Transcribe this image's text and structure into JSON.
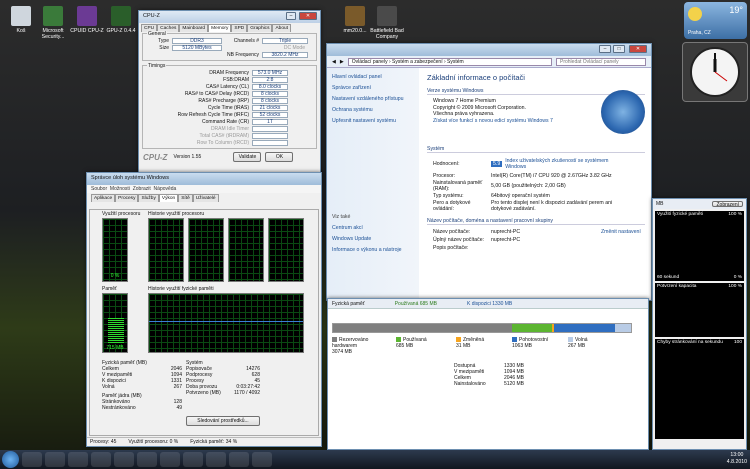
{
  "desktop": {
    "icons": [
      {
        "label": "Koš",
        "color": "#cfd6dd"
      },
      {
        "label": "Microsoft Security...",
        "color": "#3a7a3a"
      },
      {
        "label": "CPUID CPU-Z",
        "color": "#6b3a94"
      },
      {
        "label": "GPU-Z 0.4.4",
        "color": "#2a5e2a"
      },
      {
        "label": "mm20.0...",
        "color": "#7a5a2a"
      },
      {
        "label": "Battlefield Bad Company",
        "color": "#4a4a4a"
      }
    ]
  },
  "weather": {
    "temp": "19°",
    "city": "Praha, CZ"
  },
  "cpuz": {
    "title": "CPU-Z",
    "tabs": [
      "CPU",
      "Caches",
      "Mainboard",
      "Memory",
      "SPD",
      "Graphics",
      "About"
    ],
    "active_tab": "Memory",
    "general": {
      "title": "General",
      "type_label": "Type",
      "type": "DDR3",
      "channels_label": "Channels #",
      "channels": "Triple",
      "size_label": "Size",
      "size": "5120 MBytes",
      "dc_label": "DC Mode",
      "nb_label": "NB Frequency",
      "nb": "3820.2 MHz"
    },
    "timings": {
      "title": "Timings",
      "rows": [
        {
          "label": "DRAM Frequency",
          "value": "573.0 MHz"
        },
        {
          "label": "FSB:DRAM",
          "value": "2:8"
        },
        {
          "label": "CAS# Latency (CL)",
          "value": "8.0 clocks"
        },
        {
          "label": "RAS# to CAS# Delay (tRCD)",
          "value": "8 clocks"
        },
        {
          "label": "RAS# Precharge (tRP)",
          "value": "8 clocks"
        },
        {
          "label": "Cycle Time (tRAS)",
          "value": "21 clocks"
        },
        {
          "label": "Row Refresh Cycle Time (tRFC)",
          "value": "52 clocks"
        },
        {
          "label": "Command Rate (CR)",
          "value": "1T"
        },
        {
          "label": "DRAM Idle Timer",
          "value": ""
        },
        {
          "label": "Total CAS# (tRDRAM)",
          "value": ""
        },
        {
          "label": "Row To Column (tRCD)",
          "value": ""
        }
      ]
    },
    "logo": "CPU-Z",
    "version": "Version 1.55",
    "validate": "Validate",
    "ok": "OK"
  },
  "sysinfo": {
    "path": "Ovládací panely › Systém a zabezpečení › Systém",
    "search": "Prohledat Ovládací panely",
    "side": {
      "home": "Hlavní ovládací panel",
      "links": [
        "Správce zařízení",
        "Nastavení vzdáleného přístupu",
        "Ochrana systému",
        "Upřesnit nastavení systému"
      ],
      "see_also": "Viz také",
      "bottom": [
        "Centrum akcí",
        "Windows Update",
        "Informace o výkonu a nástroje"
      ]
    },
    "heading": "Základní informace o počítači",
    "edition_section": "Verze systému Windows",
    "edition": "Windows 7 Home Premium",
    "copyright": "Copyright © 2009 Microsoft Corporation. Všechna práva vyhrazena.",
    "more": "Získat více funkcí s novou edicí systému Windows 7",
    "system_section": "Systém",
    "rating_label": "Hodnocení:",
    "rating_value": "5.9",
    "rating_text": "Index uživatelských zkušeností se systémem Windows",
    "cpu_label": "Procesor:",
    "cpu": "Intel(R) Core(TM) i7 CPU     920 @ 2.67GHz   3.82 GHz",
    "ram_label": "Nainstalovaná paměť (RAM):",
    "ram": "5,00 GB (použitelných: 2,00 GB)",
    "type_label": "Typ systému:",
    "type": "64bitový operační systém",
    "pen_label": "Pero a dotykové ovládání:",
    "pen": "Pro tento displej není k dispozici zadávání perem ani dotykové zadávání.",
    "domain_section": "Název počítače, doména a nastavení pracovní skupiny",
    "pcname_label": "Název počítače:",
    "pcname": "nuprecht-PC",
    "fullname_label": "Úplný název počítače:",
    "fullname": "nuprecht-PC",
    "desc_label": "Popis počítače:",
    "change": "Změnit nastavení"
  },
  "taskmgr": {
    "title": "Správce úloh systému Windows",
    "menu": [
      "Soubor",
      "Možnosti",
      "Zobrazit",
      "Nápověda"
    ],
    "tabs": [
      "Aplikace",
      "Procesy",
      "Služby",
      "Výkon",
      "Sítě",
      "Uživatelé"
    ],
    "active_tab": "Výkon",
    "cpu_usage_label": "Využití procesoru",
    "cpu_usage": "0 %",
    "cpu_history_label": "Historie využití procesoru",
    "mem_label": "Paměť",
    "mem_value": "715 MB",
    "mem_history_label": "Historie využití fyzické paměti",
    "physmem": {
      "title": "Fyzická paměť (MB)",
      "rows": [
        {
          "k": "Celkem",
          "v": "2046"
        },
        {
          "k": "V mezipaměti",
          "v": "1094"
        },
        {
          "k": "K dispozici",
          "v": "1331"
        },
        {
          "k": "Volná",
          "v": "267"
        }
      ]
    },
    "kernel": {
      "title": "Paměť jádra (MB)",
      "rows": [
        {
          "k": "Stránkováno",
          "v": "128"
        },
        {
          "k": "Nestránkováno",
          "v": "49"
        }
      ]
    },
    "system": {
      "title": "Systém",
      "rows": [
        {
          "k": "Popisovače",
          "v": "14276"
        },
        {
          "k": "Podprocesy",
          "v": "628"
        },
        {
          "k": "Procesy",
          "v": "45"
        },
        {
          "k": "Doba provozu",
          "v": "0:03:27:42"
        },
        {
          "k": "Potvrzeno (MB)",
          "v": "1170 / 4092"
        }
      ]
    },
    "resmon_button": "Sledování prostředků...",
    "status": [
      "Procesy: 45",
      "Využití procesoru: 0 %",
      "Fyzická paměť: 34 %"
    ]
  },
  "resmon": {
    "header": "Fyzická paměť",
    "used_hdr": "Používaná 685 MB",
    "avail_hdr": "K dispozici 1330 MB",
    "legend": [
      {
        "name": "Rezervováno hardwarem",
        "value": "3074 MB",
        "color": "#7f7f7f"
      },
      {
        "name": "Používaná",
        "value": "685 MB",
        "color": "#5cb531"
      },
      {
        "name": "Změněná",
        "value": "31 MB",
        "color": "#f6a41e"
      },
      {
        "name": "Pohotovostní",
        "value": "1063 MB",
        "color": "#2f6ec0"
      },
      {
        "name": "Volná",
        "value": "267 MB",
        "color": "#b9cce6"
      }
    ],
    "totals": [
      {
        "k": "Dostupná",
        "v": "1330 MB"
      },
      {
        "k": "V mezipaměti",
        "v": "1094 MB"
      },
      {
        "k": "Celkem",
        "v": "2046 MB"
      },
      {
        "k": "Nainstalováno",
        "v": "5120 MB"
      }
    ],
    "bar_fractions": {
      "reserved": 0.6,
      "used": 0.134,
      "modified": 0.006,
      "standby": 0.208,
      "free": 0.052
    }
  },
  "rightpanel": {
    "label_mb": "MB",
    "view_label": "Zobrazení",
    "graph1_title": "Využití fyzické paměti",
    "graph1_pct": "100 %",
    "graph2_title": "Potvrzení kapacita",
    "graph2_pct": "100 %",
    "graph3_title": "Chyby stránkování na sekundu",
    "graph3_pct": "100",
    "seconds": "60 sekund",
    "zero": "0 %"
  },
  "taskbar": {
    "time": "13:00",
    "date": "4.8.2010"
  }
}
